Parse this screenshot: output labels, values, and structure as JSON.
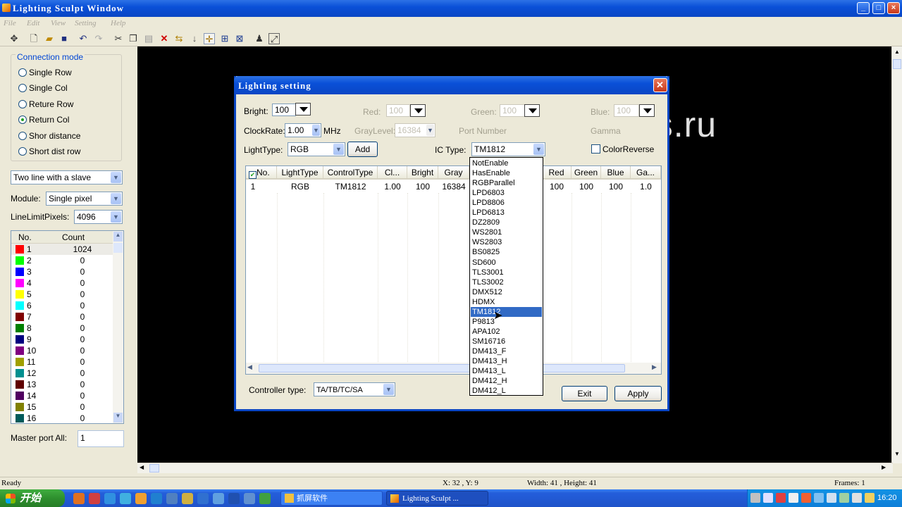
{
  "window": {
    "title": "Lighting Sculpt Window"
  },
  "menu": [
    "File",
    "Edit",
    "View",
    "Setting",
    "Help"
  ],
  "toolbar": [
    "pointer-icon",
    "new-file-icon",
    "open-folder-icon",
    "save-icon",
    "undo-icon",
    "redo-icon",
    "cut-icon",
    "copy-icon",
    "paste-icon",
    "delete-icon",
    "flip-icon",
    "move-down-icon",
    "crosshair-icon",
    "grid-icon",
    "select-box-icon",
    "people-icon",
    "image-export-icon"
  ],
  "left": {
    "connection_title": "Connection mode",
    "modes": [
      "Single Row",
      "Single Col",
      "Reture Row",
      "Return Col",
      "Shor distance",
      "Short dist row"
    ],
    "selected_mode": "Return Col",
    "slave_combo": "Two line with a slave",
    "module_label": "Module:",
    "module_value": "Single pixel",
    "linelimit_label": "LineLimitPixels:",
    "linelimit_value": "4096",
    "list_headers": [
      "No.",
      "Count"
    ],
    "rows": [
      {
        "no": "1",
        "count": "1024",
        "color": "#ff0000"
      },
      {
        "no": "2",
        "count": "0",
        "color": "#00ff00"
      },
      {
        "no": "3",
        "count": "0",
        "color": "#0000ff"
      },
      {
        "no": "4",
        "count": "0",
        "color": "#ff00ff"
      },
      {
        "no": "5",
        "count": "0",
        "color": "#ffff00"
      },
      {
        "no": "6",
        "count": "0",
        "color": "#00ffff"
      },
      {
        "no": "7",
        "count": "0",
        "color": "#800000"
      },
      {
        "no": "8",
        "count": "0",
        "color": "#008000"
      },
      {
        "no": "9",
        "count": "0",
        "color": "#000080"
      },
      {
        "no": "10",
        "count": "0",
        "color": "#800080"
      },
      {
        "no": "11",
        "count": "0",
        "color": "#a0a000"
      },
      {
        "no": "12",
        "count": "0",
        "color": "#009090"
      },
      {
        "no": "13",
        "count": "0",
        "color": "#600000"
      },
      {
        "no": "14",
        "count": "0",
        "color": "#500060"
      },
      {
        "no": "15",
        "count": "0",
        "color": "#808000"
      },
      {
        "no": "16",
        "count": "0",
        "color": "#005a5a"
      }
    ],
    "master_label": "Master port All:",
    "master_value": "1"
  },
  "dialog": {
    "title": "Lighting setting",
    "bright_label": "Bright:",
    "bright_value": "100",
    "red_label": "Red:",
    "red_value": "100",
    "green_label": "Green:",
    "green_value": "100",
    "blue_label": "Blue:",
    "blue_value": "100",
    "clock_label": "ClockRate:",
    "clock_value": "1.00",
    "clock_unit": "MHz",
    "graylevel_label": "GrayLevel:",
    "graylevel_value": "16384",
    "portnumber_label": "Port Number",
    "gamma_label": "Gamma",
    "lighttype_label": "LightType:",
    "lighttype_value": "RGB",
    "add_label": "Add",
    "ictype_label": "IC Type:",
    "ictype_value": "TM1812",
    "colorreverse_label": "ColorReverse",
    "columns": [
      "No.",
      "LightType",
      "ControlType",
      "Cl...",
      "Bright",
      "Gray",
      "Red",
      "Green",
      "Blue",
      "Ga..."
    ],
    "row": [
      "1",
      "RGB",
      "TM1812",
      "1.00",
      "100",
      "16384",
      "100",
      "100",
      "100",
      "1.0"
    ],
    "controller_label": "Controller type:",
    "controller_value": "TA/TB/TC/SA",
    "exit_label": "Exit",
    "apply_label": "Apply",
    "ic_options": [
      "NotEnable",
      "HasEnable",
      "RGBParallel",
      "LPD6803",
      "LPD8806",
      "LPD6813",
      "DZ2809",
      "WS2801",
      "WS2803",
      "BS0825",
      "SD600",
      "TLS3001",
      "TLS3002",
      "DMX512",
      "HDMX",
      "TM1812",
      "P9813",
      "APA102",
      "SM16716",
      "DM413_F",
      "DM413_H",
      "DM413_L",
      "DM412_H",
      "DM412_L"
    ],
    "ic_selected": "TM1812"
  },
  "watermark": "www.chinaleds.ru",
  "status": {
    "ready": "Ready",
    "coords": "X: 32 , Y: 9",
    "size": "Width: 41 , Height: 41",
    "frames": "Frames: 1"
  },
  "taskbar": {
    "start": "开始",
    "task1": "抓屏软件",
    "task2": "Lighting Sculpt ...",
    "time": "16:20"
  }
}
